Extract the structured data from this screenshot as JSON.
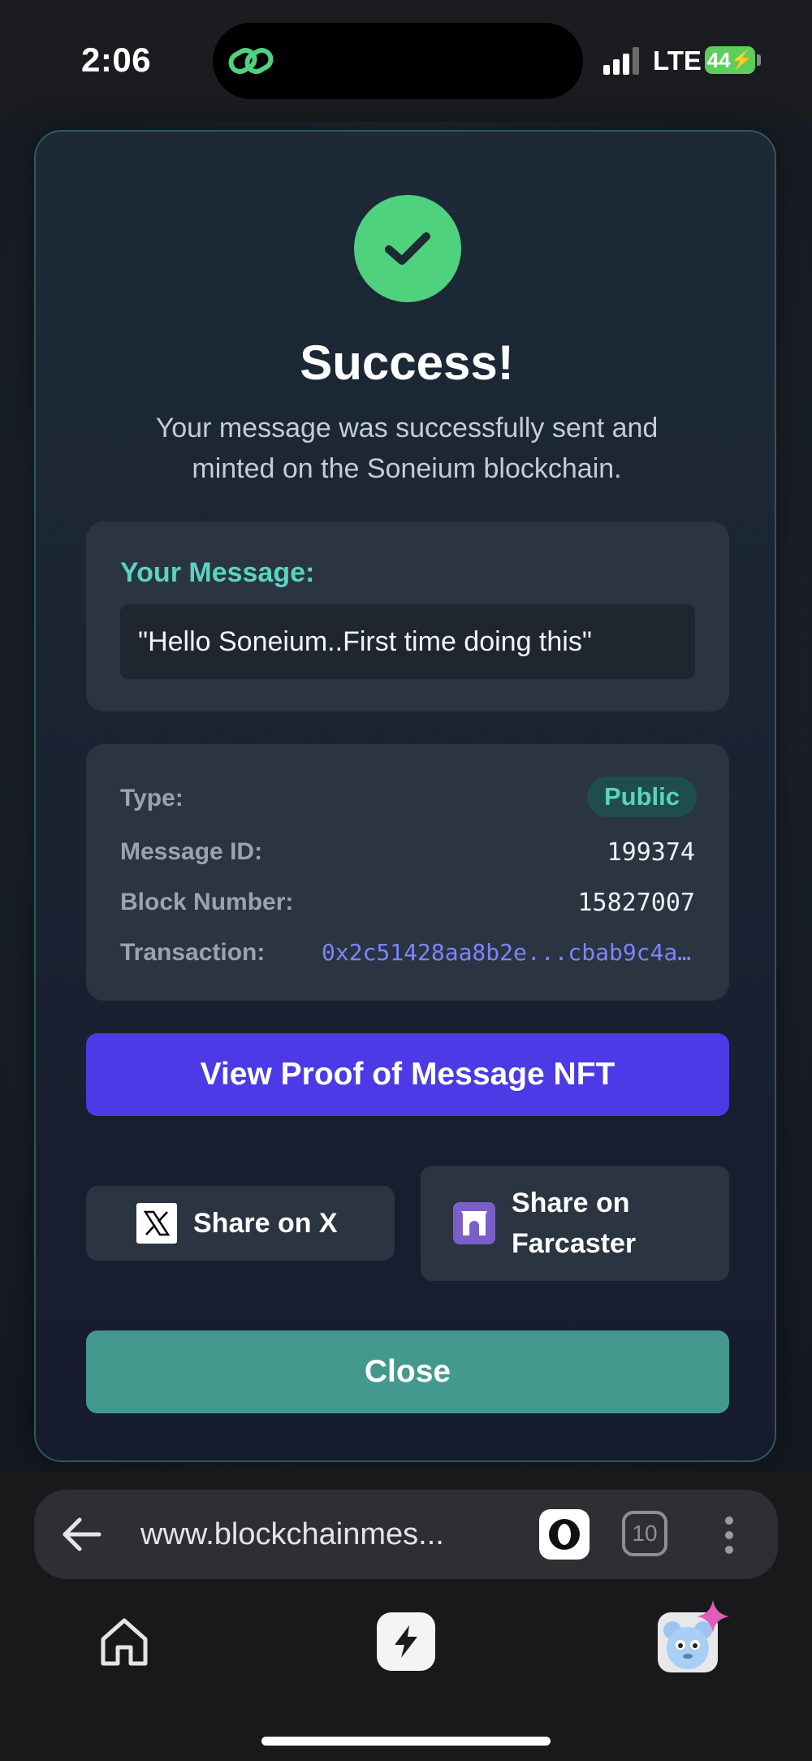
{
  "status_bar": {
    "time": "2:06",
    "network": "LTE",
    "battery": "44"
  },
  "modal": {
    "title": "Success!",
    "subtitle": "Your message was successfully sent and minted on the Soneium blockchain.",
    "message_label": "Your Message:",
    "message_text": "\"Hello Soneium..First time doing this\"",
    "details": {
      "type_label": "Type:",
      "type_value": "Public",
      "message_id_label": "Message ID:",
      "message_id_value": "199374",
      "block_number_label": "Block Number:",
      "block_number_value": "15827007",
      "transaction_label": "Transaction:",
      "transaction_value": "0x2c51428aa8b2e...cbab9c4a…"
    },
    "proof_button": "View Proof of Message NFT",
    "share_x_button": "Share on X",
    "share_farcaster_line1": "Share on",
    "share_farcaster_line2": "Farcaster",
    "close_button": "Close"
  },
  "browser": {
    "url": "www.blockchainmes...",
    "tab_count": "10"
  },
  "colors": {
    "success_green": "#4fd17e",
    "accent_teal": "#5ad3c0",
    "primary_purple": "#4b3ae6",
    "close_teal": "#44998f",
    "link_blue": "#7a86ff"
  }
}
